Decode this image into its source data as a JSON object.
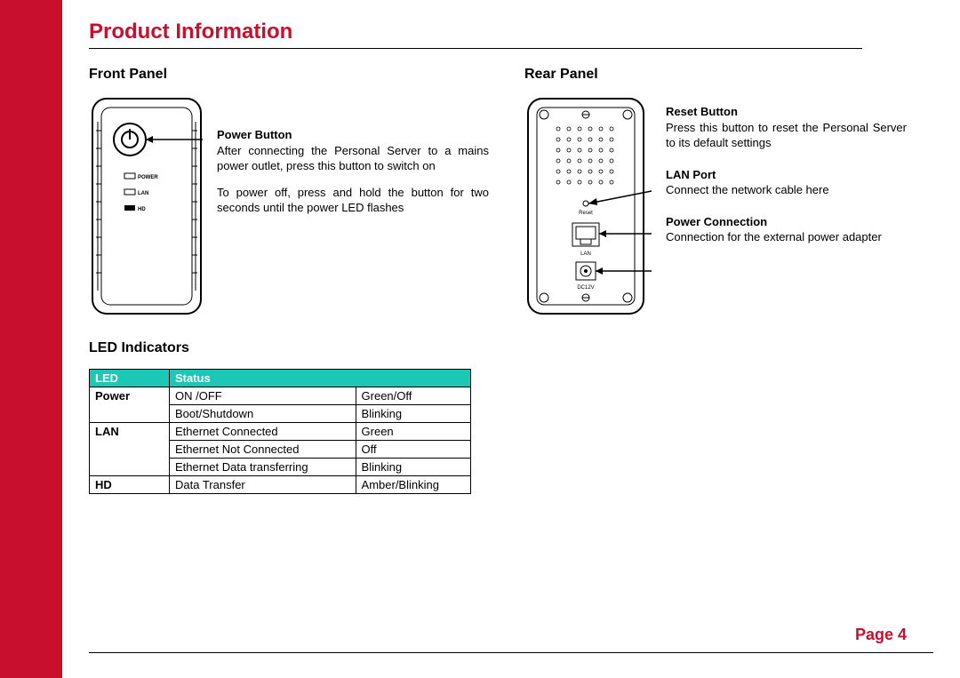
{
  "title": "Product Information",
  "front": {
    "heading": "Front Panel",
    "labels": {
      "power": "POWER",
      "lan": "LAN",
      "hd": "HD"
    },
    "power_button": {
      "title": "Power Button",
      "body1": "After connecting the Personal Server to a mains power outlet, press this button to switch on",
      "body2": "To power off, press and hold the button for two seconds until the power LED flashes"
    }
  },
  "led": {
    "heading": "LED Indicators",
    "header": {
      "c1": "LED",
      "c2": "Status"
    },
    "rows": [
      {
        "a": "Power",
        "b": "ON /OFF",
        "c": "Green/Off"
      },
      {
        "a": "",
        "b": "Boot/Shutdown",
        "c": "Blinking"
      },
      {
        "a": "LAN",
        "b": "Ethernet Connected",
        "c": "Green"
      },
      {
        "a": "",
        "b": "Ethernet Not Connected",
        "c": "Off"
      },
      {
        "a": "",
        "b": "Ethernet Data transferring",
        "c": "Blinking"
      },
      {
        "a": "HD",
        "b": "Data Transfer",
        "c": "Amber/Blinking"
      }
    ]
  },
  "rear": {
    "heading": "Rear Panel",
    "labels": {
      "reset": "Reset",
      "lan": "LAN",
      "dc": "DC12V"
    },
    "reset": {
      "title": "Reset Button",
      "body": "Press this button to reset the Personal Server to its default settings"
    },
    "lan": {
      "title": "LAN Port",
      "body": "Connect the network cable here"
    },
    "power": {
      "title": "Power Connection",
      "body": "Connection for the external power adapter"
    }
  },
  "page_label": "Page 4"
}
